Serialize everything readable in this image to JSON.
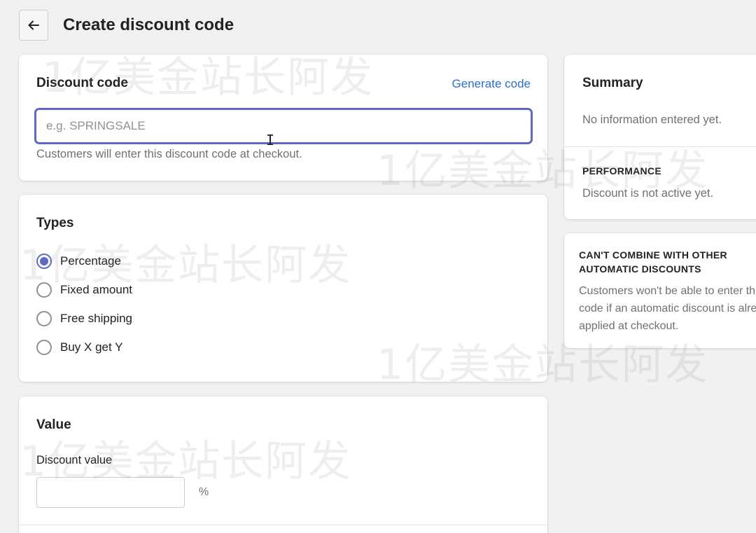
{
  "header": {
    "back_icon": "arrow-left-icon",
    "title": "Create discount code"
  },
  "discount_code": {
    "title": "Discount code",
    "generate_label": "Generate code",
    "input_value": "",
    "input_placeholder": "e.g. SPRINGSALE",
    "help_text": "Customers will enter this discount code at checkout."
  },
  "types": {
    "title": "Types",
    "options": [
      {
        "label": "Percentage",
        "checked": true
      },
      {
        "label": "Fixed amount",
        "checked": false
      },
      {
        "label": "Free shipping",
        "checked": false
      },
      {
        "label": "Buy X get Y",
        "checked": false
      }
    ]
  },
  "value": {
    "title": "Value",
    "field_label": "Discount value",
    "input_value": "",
    "suffix": "%"
  },
  "summary": {
    "title": "Summary",
    "empty_text": "No information entered yet.",
    "performance_heading": "PERFORMANCE",
    "performance_text": "Discount is not active yet."
  },
  "combine": {
    "heading": "CAN'T COMBINE WITH OTHER AUTOMATIC DISCOUNTS",
    "text": "Customers won't be able to enter this code if an automatic discount is already applied at checkout."
  },
  "watermark": "1亿美金站长阿发",
  "colors": {
    "accent": "#5c6ac4",
    "link": "#2c6ecb",
    "background": "#f1f1f1"
  }
}
